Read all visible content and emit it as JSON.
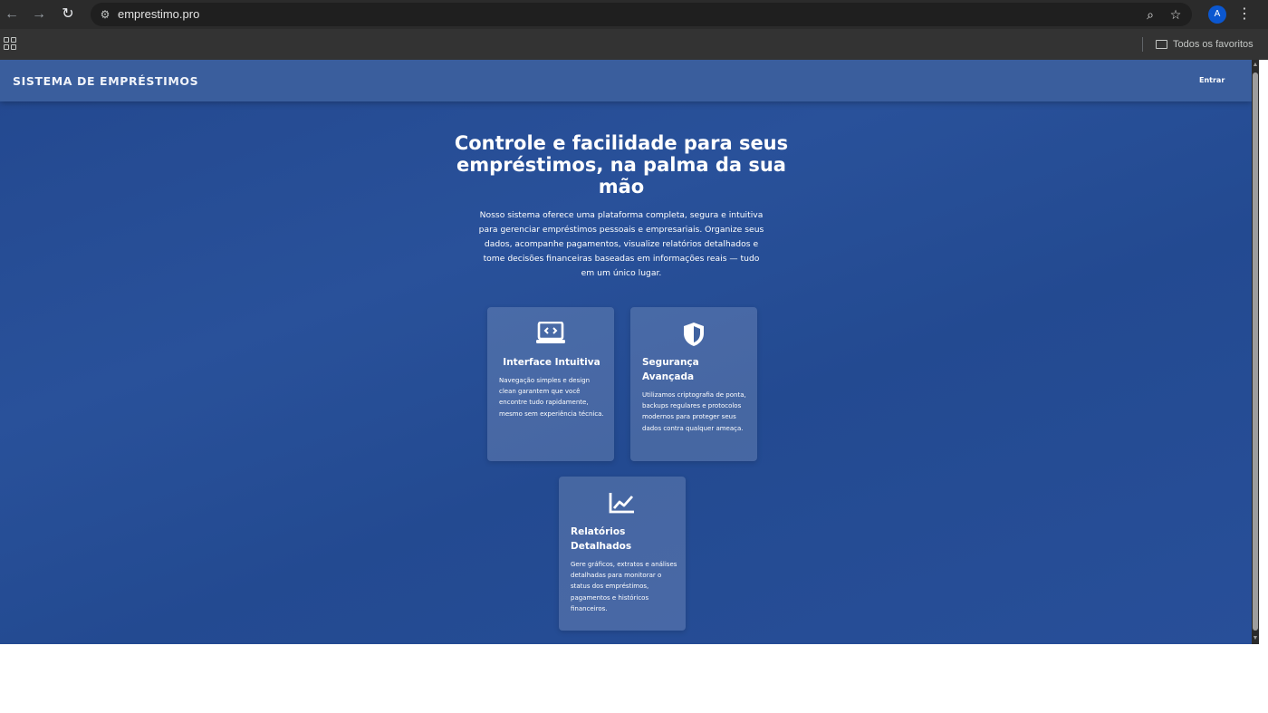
{
  "browser": {
    "url": "emprestimo.pro",
    "profile_initial": "A",
    "bookmarks_folder": "Todos os favoritos"
  },
  "header": {
    "brand": "SISTEMA DE EMPRÉSTIMOS",
    "login_label": "Entrar"
  },
  "hero": {
    "title": "Controle e facilidade para seus empréstimos, na palma da sua mão",
    "description": "Nosso sistema oferece uma plataforma completa, segura e intuitiva para gerenciar empréstimos pessoais e empresariais. Organize seus dados, acompanhe pagamentos, visualize relatórios detalhados e tome decisões financeiras baseadas em informações reais — tudo em um único lugar."
  },
  "features": [
    {
      "icon": "laptop-code-icon",
      "title": "Interface Intuitiva",
      "text": "Navegação simples e design clean garantem que você encontre tudo rapidamente, mesmo sem experiência técnica."
    },
    {
      "icon": "shield-icon",
      "title": "Segurança Avançada",
      "text": "Utilizamos criptografia de ponta, backups regulares e protocolos modernos para proteger seus dados contra qualquer ameaça."
    },
    {
      "icon": "chart-line-icon",
      "title": "Relatórios Detalhados",
      "text": "Gere gráficos, extratos e análises detalhadas para monitorar o status dos empréstimos, pagamentos e históricos financeiros."
    }
  ],
  "colors": {
    "page_background": "#264c95",
    "header_background": "#3a5e9d",
    "card_background": "rgba(255,255,255,0.16)",
    "text": "#ffffff"
  }
}
